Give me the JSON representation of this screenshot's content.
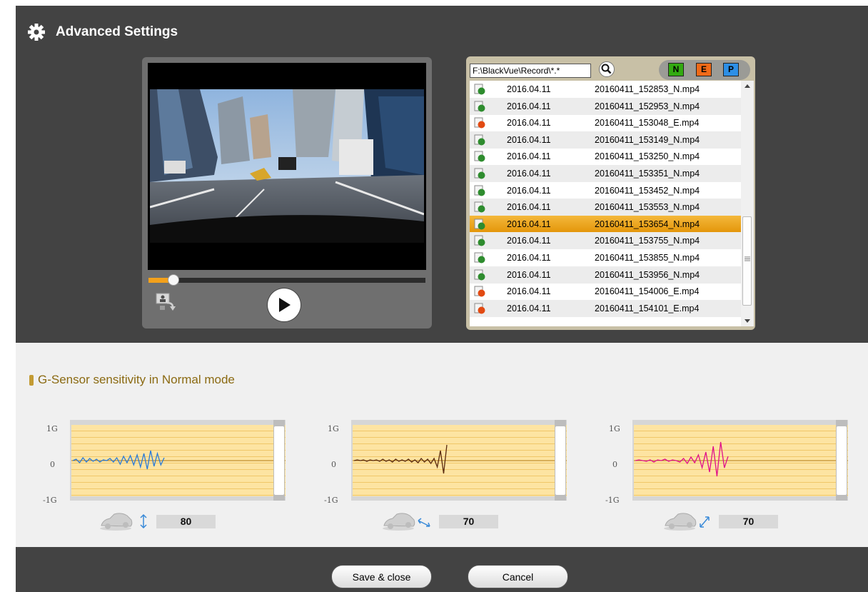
{
  "window": {
    "title": "Advanced Settings"
  },
  "player": {
    "seek_progress": 0.08
  },
  "file_list": {
    "path": "F:\\BlackVue\\Record\\*.*",
    "filters": [
      {
        "label": "N",
        "color": "#33aa11"
      },
      {
        "label": "E",
        "color": "#f06a18"
      },
      {
        "label": "P",
        "color": "#2d8fe6"
      }
    ],
    "rows": [
      {
        "type": "N",
        "date": "2016.04.11",
        "file": "20160411_152853_N.mp4"
      },
      {
        "type": "N",
        "date": "2016.04.11",
        "file": "20160411_152953_N.mp4"
      },
      {
        "type": "E",
        "date": "2016.04.11",
        "file": "20160411_153048_E.mp4"
      },
      {
        "type": "N",
        "date": "2016.04.11",
        "file": "20160411_153149_N.mp4"
      },
      {
        "type": "N",
        "date": "2016.04.11",
        "file": "20160411_153250_N.mp4"
      },
      {
        "type": "N",
        "date": "2016.04.11",
        "file": "20160411_153351_N.mp4"
      },
      {
        "type": "N",
        "date": "2016.04.11",
        "file": "20160411_153452_N.mp4"
      },
      {
        "type": "N",
        "date": "2016.04.11",
        "file": "20160411_153553_N.mp4"
      },
      {
        "type": "N",
        "date": "2016.04.11",
        "file": "20160411_153654_N.mp4",
        "selected": true
      },
      {
        "type": "N",
        "date": "2016.04.11",
        "file": "20160411_153755_N.mp4"
      },
      {
        "type": "N",
        "date": "2016.04.11",
        "file": "20160411_153855_N.mp4"
      },
      {
        "type": "N",
        "date": "2016.04.11",
        "file": "20160411_153956_N.mp4"
      },
      {
        "type": "E",
        "date": "2016.04.11",
        "file": "20160411_154006_E.mp4"
      },
      {
        "type": "E",
        "date": "2016.04.11",
        "file": "20160411_154101_E.mp4"
      }
    ]
  },
  "gsensor": {
    "title": "G-Sensor sensitivity in Normal mode",
    "axis": {
      "top": "1G",
      "mid": "0",
      "bottom": "-1G"
    },
    "graphs": [
      {
        "axis_name": "vertical",
        "value": "80",
        "line_color": "#2b7bd8"
      },
      {
        "axis_name": "horizontal",
        "value": "70",
        "line_color": "#5a2a0e"
      },
      {
        "axis_name": "diagonal",
        "value": "70",
        "line_color": "#e0108a"
      }
    ]
  },
  "footer": {
    "save_label": "Save & close",
    "cancel_label": "Cancel"
  }
}
